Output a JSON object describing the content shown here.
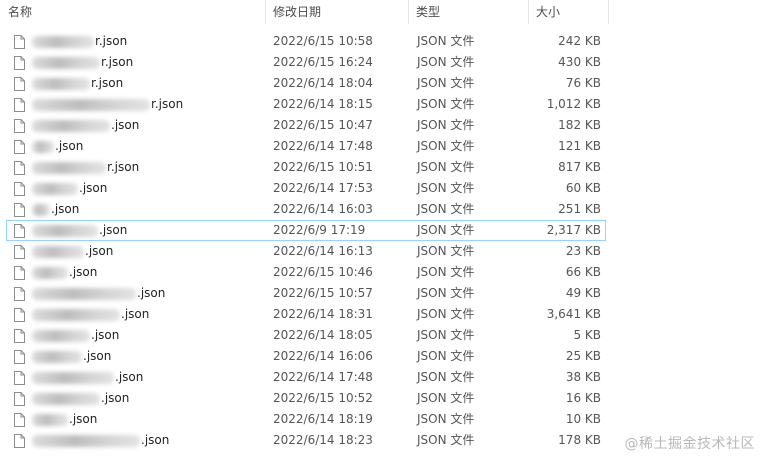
{
  "headers": {
    "name": "名称",
    "modified": "修改日期",
    "type": "类型",
    "size": "大小"
  },
  "sort_glyph": "^",
  "files": [
    {
      "name": "r.json",
      "modified": "2022/6/15 10:58",
      "type": "JSON 文件",
      "size": "242 KB",
      "selected": false
    },
    {
      "name": "r.json",
      "modified": "2022/6/15 16:24",
      "type": "JSON 文件",
      "size": "430 KB",
      "selected": false
    },
    {
      "name": "r.json",
      "modified": "2022/6/14 18:04",
      "type": "JSON 文件",
      "size": "76 KB",
      "selected": false
    },
    {
      "name": "r.json",
      "modified": "2022/6/14 18:15",
      "type": "JSON 文件",
      "size": "1,012 KB",
      "selected": false
    },
    {
      "name": ".json",
      "modified": "2022/6/15 10:47",
      "type": "JSON 文件",
      "size": "182 KB",
      "selected": false
    },
    {
      "name": ".json",
      "modified": "2022/6/14 17:48",
      "type": "JSON 文件",
      "size": "121 KB",
      "selected": false
    },
    {
      "name": "r.json",
      "modified": "2022/6/15 10:51",
      "type": "JSON 文件",
      "size": "817 KB",
      "selected": false
    },
    {
      "name": ".json",
      "modified": "2022/6/14 17:53",
      "type": "JSON 文件",
      "size": "60 KB",
      "selected": false
    },
    {
      "name": ".json",
      "modified": "2022/6/14 16:03",
      "type": "JSON 文件",
      "size": "251 KB",
      "selected": false
    },
    {
      "name": ".json",
      "modified": "2022/6/9 17:19",
      "type": "JSON 文件",
      "size": "2,317 KB",
      "selected": true
    },
    {
      "name": ".json",
      "modified": "2022/6/14 16:13",
      "type": "JSON 文件",
      "size": "23 KB",
      "selected": false
    },
    {
      "name": ".json",
      "modified": "2022/6/15 10:46",
      "type": "JSON 文件",
      "size": "66 KB",
      "selected": false
    },
    {
      "name": ".json",
      "modified": "2022/6/15 10:57",
      "type": "JSON 文件",
      "size": "49 KB",
      "selected": false
    },
    {
      "name": ".json",
      "modified": "2022/6/14 18:31",
      "type": "JSON 文件",
      "size": "3,641 KB",
      "selected": false
    },
    {
      "name": ".json",
      "modified": "2022/6/14 18:05",
      "type": "JSON 文件",
      "size": "5 KB",
      "selected": false
    },
    {
      "name": ".json",
      "modified": "2022/6/14 16:06",
      "type": "JSON 文件",
      "size": "25 KB",
      "selected": false
    },
    {
      "name": ".json",
      "modified": "2022/6/14 17:48",
      "type": "JSON 文件",
      "size": "38 KB",
      "selected": false
    },
    {
      "name": ".json",
      "modified": "2022/6/15 10:52",
      "type": "JSON 文件",
      "size": "16 KB",
      "selected": false
    },
    {
      "name": ".json",
      "modified": "2022/6/14 18:19",
      "type": "JSON 文件",
      "size": "10 KB",
      "selected": false
    },
    {
      "name": ".json",
      "modified": "2022/6/14 18:23",
      "type": "JSON 文件",
      "size": "178 KB",
      "selected": false
    }
  ],
  "watermark": "@稀土掘金技术社区"
}
